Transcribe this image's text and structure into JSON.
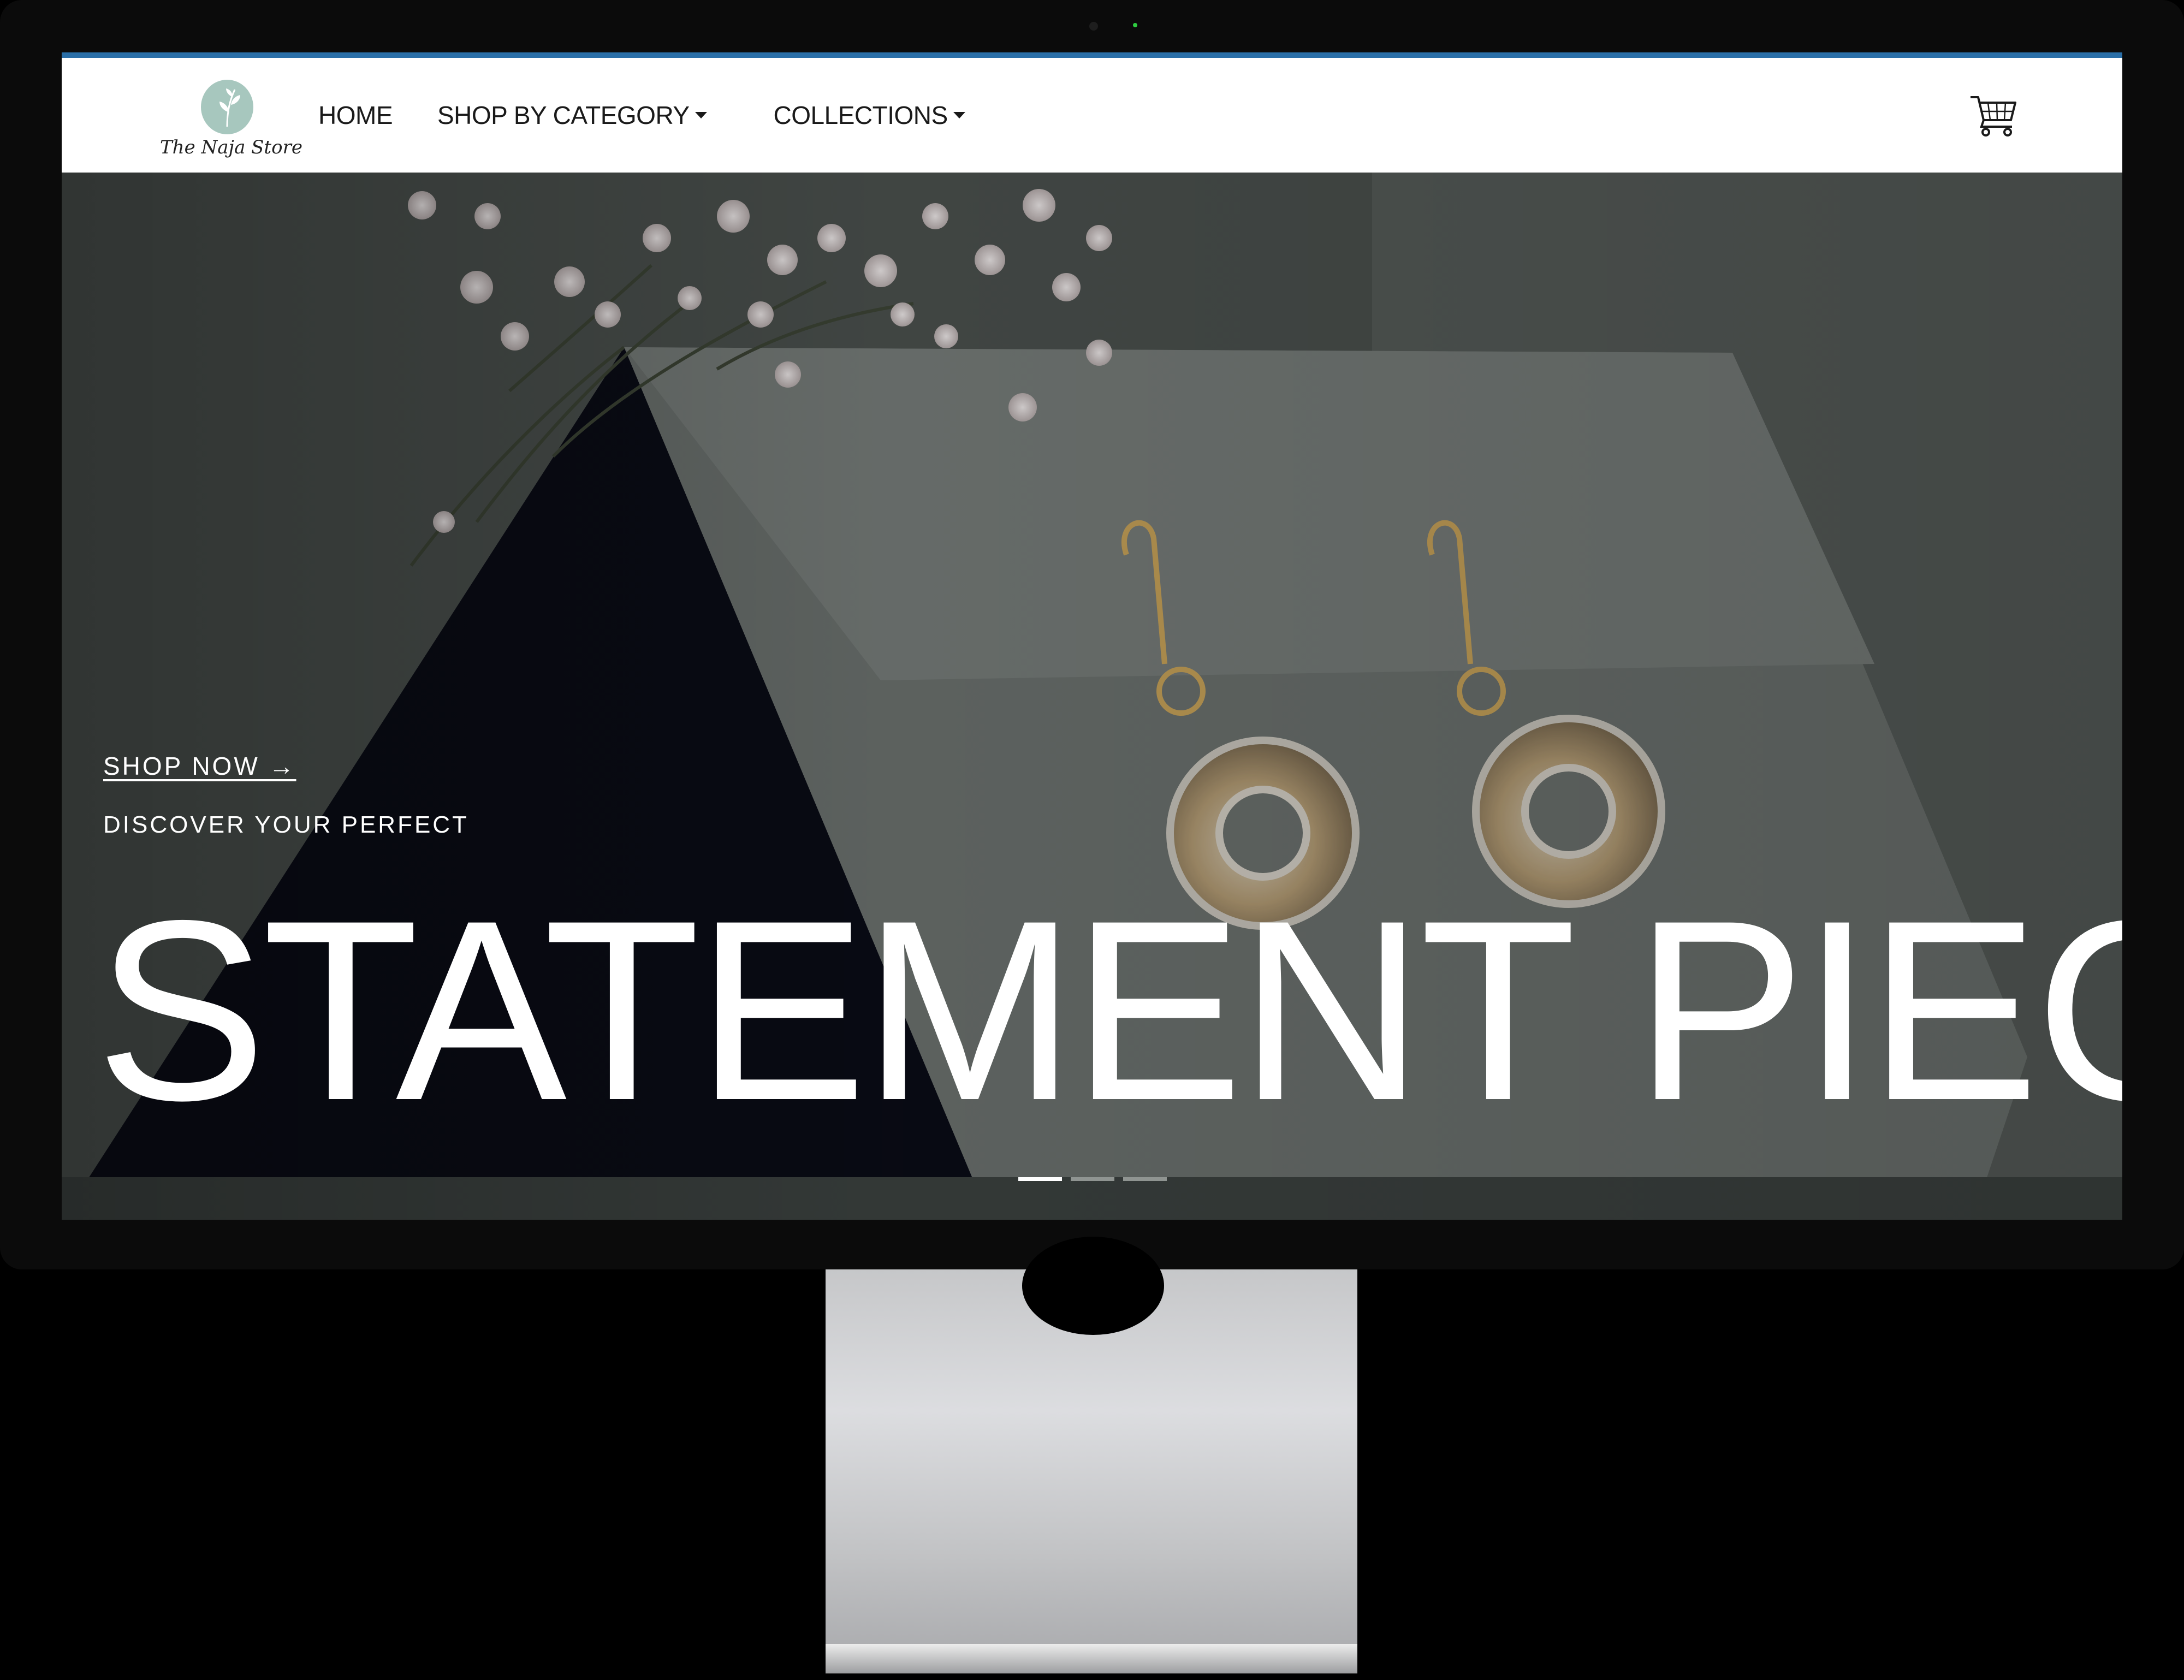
{
  "brand": {
    "logo_text": "The Naja Store"
  },
  "nav": {
    "items": [
      {
        "label": "HOME"
      },
      {
        "label": "SHOP BY CATEGORY"
      },
      {
        "label": "COLLECTIONS"
      }
    ]
  },
  "hero": {
    "cta": "SHOP NOW →",
    "subtitle": "DISCOVER YOUR PERFECT",
    "headline": "STATEMENT PIECE",
    "slides_total": 3,
    "active_slide": 1
  },
  "colors": {
    "accent_bar": "#2a6fa8",
    "logo_mark": "#a7c7be",
    "hero_text": "#ffffff"
  },
  "icons": [
    "shopping-cart-icon",
    "caret-down-icon",
    "leaf-logo-icon"
  ]
}
